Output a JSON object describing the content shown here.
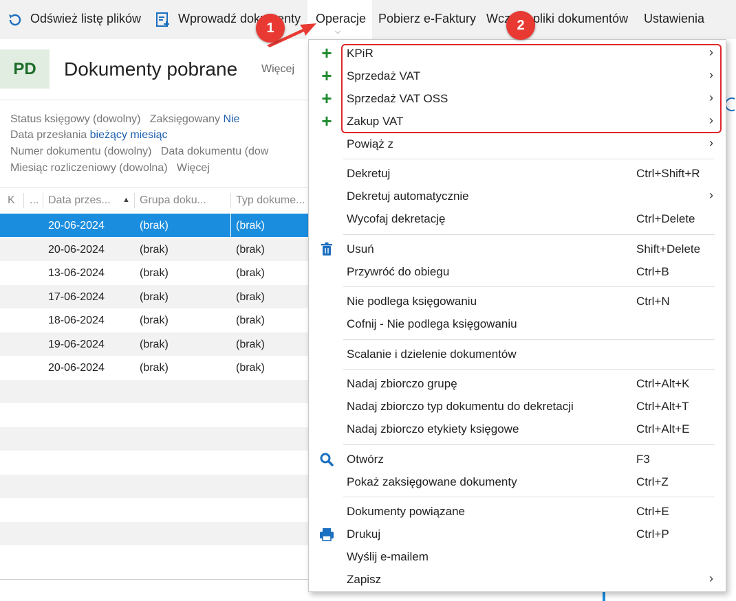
{
  "toolbar": {
    "refresh_label": "Odśwież listę plików",
    "import_label": "Wprowadź dokumenty",
    "operations_label": "Operacje",
    "download_label": "Pobierz e-Faktury",
    "load_label": "Wczytaj pliki dokumentów",
    "settings_label": "Ustawienia"
  },
  "header": {
    "badge": "PD",
    "title": "Dokumenty pobrane",
    "more": "Więcej"
  },
  "filters": {
    "status": "Status księgowy (dowolny)",
    "posted_label": "Zaksięgowany",
    "posted_value": "Nie",
    "date_label": "Data przesłania",
    "date_value": "bieżący miesiąc",
    "number": "Numer dokumentu (dowolny)",
    "doc_date": "Data dokumentu (dow",
    "month": "Miesiąc rozliczeniowy (dowolna)",
    "more": "Więcej"
  },
  "grid": {
    "columns": [
      "K",
      "...",
      "Data przes...",
      "Grupa doku...",
      "Typ dokume..."
    ],
    "rows": [
      {
        "date": "20-06-2024",
        "group": "(brak)",
        "type": "(brak)"
      },
      {
        "date": "20-06-2024",
        "group": "(brak)",
        "type": "(brak)"
      },
      {
        "date": "13-06-2024",
        "group": "(brak)",
        "type": "(brak)"
      },
      {
        "date": "17-06-2024",
        "group": "(brak)",
        "type": "(brak)"
      },
      {
        "date": "18-06-2024",
        "group": "(brak)",
        "type": "(brak)"
      },
      {
        "date": "19-06-2024",
        "group": "(brak)",
        "type": "(brak)"
      },
      {
        "date": "20-06-2024",
        "group": "(brak)",
        "type": "(brak)"
      }
    ]
  },
  "menu": {
    "items": [
      {
        "label": "KPiR",
        "shortcut": "",
        "submenu": true,
        "icon": "plus-icon"
      },
      {
        "label": "Sprzedaż VAT",
        "shortcut": "",
        "submenu": true,
        "icon": "plus-icon"
      },
      {
        "label": "Sprzedaż VAT OSS",
        "shortcut": "",
        "submenu": true,
        "icon": "plus-icon"
      },
      {
        "label": "Zakup VAT",
        "shortcut": "",
        "submenu": true,
        "icon": "plus-icon"
      },
      {
        "label": "Powiąż z",
        "shortcut": "",
        "submenu": true,
        "icon": ""
      },
      {
        "label": "Dekretuj",
        "shortcut": "Ctrl+Shift+R",
        "submenu": false,
        "icon": ""
      },
      {
        "label": "Dekretuj automatycznie",
        "shortcut": "",
        "submenu": true,
        "icon": ""
      },
      {
        "label": "Wycofaj dekretację",
        "shortcut": "Ctrl+Delete",
        "submenu": false,
        "icon": ""
      },
      {
        "label": "Usuń",
        "shortcut": "Shift+Delete",
        "submenu": false,
        "icon": "trash-icon"
      },
      {
        "label": "Przywróć do obiegu",
        "shortcut": "Ctrl+B",
        "submenu": false,
        "icon": ""
      },
      {
        "label": "Nie podlega księgowaniu",
        "shortcut": "Ctrl+N",
        "submenu": false,
        "icon": ""
      },
      {
        "label": "Cofnij - Nie podlega księgowaniu",
        "shortcut": "",
        "submenu": false,
        "icon": ""
      },
      {
        "label": "Scalanie i dzielenie dokumentów",
        "shortcut": "",
        "submenu": false,
        "icon": ""
      },
      {
        "label": "Nadaj zbiorczo grupę",
        "shortcut": "Ctrl+Alt+K",
        "submenu": false,
        "icon": ""
      },
      {
        "label": "Nadaj zbiorczo typ dokumentu do dekretacji",
        "shortcut": "Ctrl+Alt+T",
        "submenu": false,
        "icon": ""
      },
      {
        "label": "Nadaj zbiorczo etykiety księgowe",
        "shortcut": "Ctrl+Alt+E",
        "submenu": false,
        "icon": ""
      },
      {
        "label": "Otwórz",
        "shortcut": "F3",
        "submenu": false,
        "icon": "search-icon"
      },
      {
        "label": "Pokaż zaksięgowane dokumenty",
        "shortcut": "Ctrl+Z",
        "submenu": false,
        "icon": ""
      },
      {
        "label": "Dokumenty powiązane",
        "shortcut": "Ctrl+E",
        "submenu": false,
        "icon": ""
      },
      {
        "label": "Drukuj",
        "shortcut": "Ctrl+P",
        "submenu": false,
        "icon": "printer-icon"
      },
      {
        "label": "Wyślij e-mailem",
        "shortcut": "",
        "submenu": false,
        "icon": ""
      },
      {
        "label": "Zapisz",
        "shortcut": "",
        "submenu": true,
        "icon": ""
      }
    ]
  },
  "callouts": [
    "1",
    "2"
  ],
  "colors": {
    "accent": "#1b8ddf",
    "plus": "#1e8a2e",
    "callout": "#e83a33",
    "highlight_border": "#e0262b"
  }
}
